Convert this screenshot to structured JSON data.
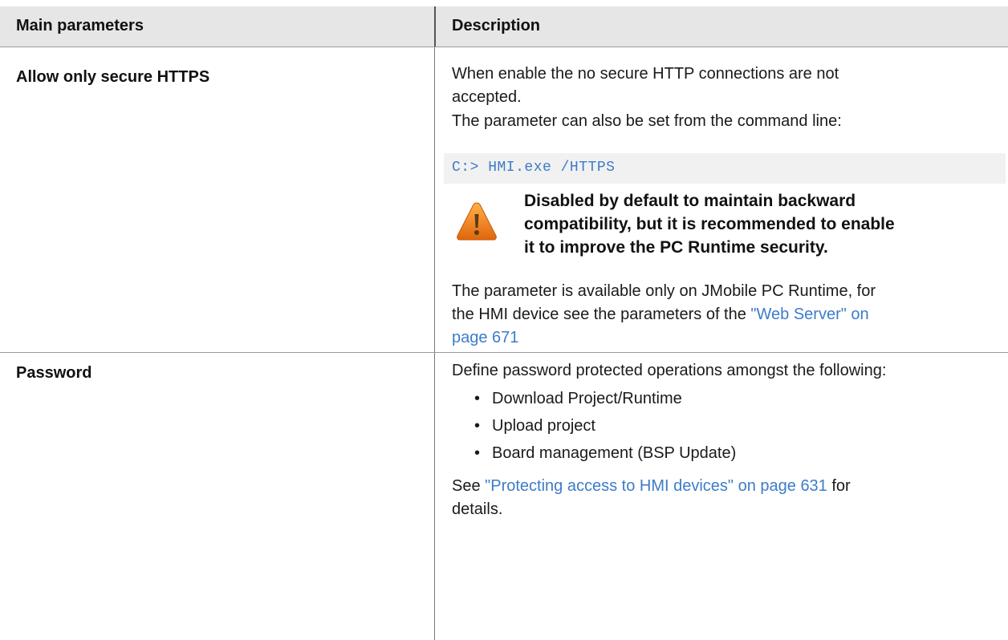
{
  "header": {
    "col1": "Main parameters",
    "col2": "Description"
  },
  "rows": [
    {
      "param": "Allow only secure HTTPS",
      "desc1_line1": "When enable the no secure HTTP connections are not",
      "desc1_line2": "accepted.",
      "desc2": "The parameter can also be set from the command line:",
      "code": "C:> HMI.exe /HTTPS",
      "warning_icon": "warning-triangle-icon",
      "warning_line1": "Disabled by default to maintain backward",
      "warning_line2": "compatibility, but it is recommended to enable",
      "warning_line3": "it to improve the PC Runtime security.",
      "desc3_line1": "The parameter is available only on JMobile PC Runtime, for",
      "desc3_line2_prefix": "the HMI device see the parameters of the ",
      "desc3_link_part1": "\"Web Server\" on",
      "desc3_link_part2": "page 671"
    },
    {
      "param": "Password",
      "desc1": "Define password  protected operations amongst the following:",
      "bullets": [
        "Download Project/Runtime",
        "Upload project",
        "Board management (BSP Update)"
      ],
      "see_prefix": "See ",
      "see_link": "\"Protecting access to HMI devices\" on page 631",
      "see_suffix": " for",
      "see_line2": "details."
    }
  ],
  "colors": {
    "header_bg": "#e6e6e6",
    "link": "#3d7cc9",
    "code_bg": "#f1f1f1",
    "warning_orange": "#f07a18"
  }
}
